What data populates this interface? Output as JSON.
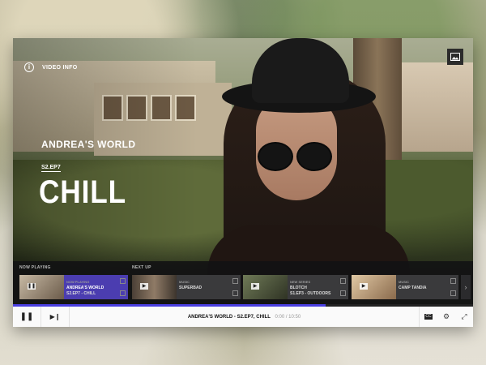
{
  "player": {
    "video_info_label": "VIDEO INFO",
    "show_title": "ANDREA'S WORLD",
    "episode_code": "S2.EP7",
    "episode_title": "CHILL"
  },
  "strip": {
    "now_playing_label": "NOW PLAYING",
    "next_up_label": "NEXT UP",
    "now_playing": {
      "meta": "NOW PLAYING",
      "line1": "ANDREA'S WORLD",
      "line2": "S2.EP7 - CHILL"
    },
    "next_up": [
      {
        "meta": "MUSIC",
        "line1": "SUPERBAD",
        "line2": ""
      },
      {
        "meta": "NEW SERIES",
        "line1": "BLOTCH",
        "line2": "S1.EP3 - OUTDOORS"
      },
      {
        "meta": "MUSIC",
        "line1": "CAMP TANDIA",
        "line2": ""
      }
    ],
    "next_arrow": "›"
  },
  "progress": {
    "fraction": 0.68
  },
  "controls": {
    "now_title": "ANDREA'S WORLD - S2.EP7, CHILL",
    "time": "0:00 / 10:50",
    "pause_icon": "❚❚",
    "next_icon": "▶❙",
    "cc_icon": "CC",
    "settings_icon": "⚙",
    "fullscreen_icon": "⤢"
  },
  "colors": {
    "accent": "#4b3db0",
    "progress": "#4a3fe0",
    "bar_bg": "#fafafa"
  }
}
